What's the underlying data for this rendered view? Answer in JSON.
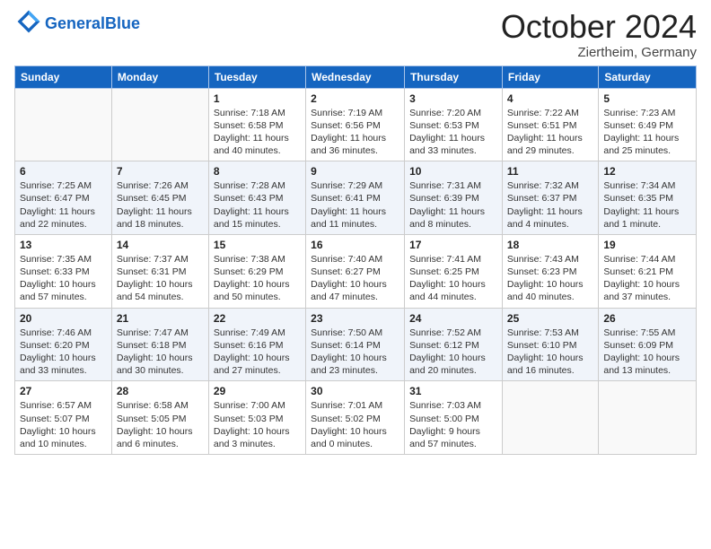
{
  "header": {
    "logo_general": "General",
    "logo_blue": "Blue",
    "month": "October 2024",
    "location": "Ziertheim, Germany"
  },
  "weekdays": [
    "Sunday",
    "Monday",
    "Tuesday",
    "Wednesday",
    "Thursday",
    "Friday",
    "Saturday"
  ],
  "weeks": [
    [
      {
        "day": "",
        "info": ""
      },
      {
        "day": "",
        "info": ""
      },
      {
        "day": "1",
        "info": "Sunrise: 7:18 AM\nSunset: 6:58 PM\nDaylight: 11 hours and 40 minutes."
      },
      {
        "day": "2",
        "info": "Sunrise: 7:19 AM\nSunset: 6:56 PM\nDaylight: 11 hours and 36 minutes."
      },
      {
        "day": "3",
        "info": "Sunrise: 7:20 AM\nSunset: 6:53 PM\nDaylight: 11 hours and 33 minutes."
      },
      {
        "day": "4",
        "info": "Sunrise: 7:22 AM\nSunset: 6:51 PM\nDaylight: 11 hours and 29 minutes."
      },
      {
        "day": "5",
        "info": "Sunrise: 7:23 AM\nSunset: 6:49 PM\nDaylight: 11 hours and 25 minutes."
      }
    ],
    [
      {
        "day": "6",
        "info": "Sunrise: 7:25 AM\nSunset: 6:47 PM\nDaylight: 11 hours and 22 minutes."
      },
      {
        "day": "7",
        "info": "Sunrise: 7:26 AM\nSunset: 6:45 PM\nDaylight: 11 hours and 18 minutes."
      },
      {
        "day": "8",
        "info": "Sunrise: 7:28 AM\nSunset: 6:43 PM\nDaylight: 11 hours and 15 minutes."
      },
      {
        "day": "9",
        "info": "Sunrise: 7:29 AM\nSunset: 6:41 PM\nDaylight: 11 hours and 11 minutes."
      },
      {
        "day": "10",
        "info": "Sunrise: 7:31 AM\nSunset: 6:39 PM\nDaylight: 11 hours and 8 minutes."
      },
      {
        "day": "11",
        "info": "Sunrise: 7:32 AM\nSunset: 6:37 PM\nDaylight: 11 hours and 4 minutes."
      },
      {
        "day": "12",
        "info": "Sunrise: 7:34 AM\nSunset: 6:35 PM\nDaylight: 11 hours and 1 minute."
      }
    ],
    [
      {
        "day": "13",
        "info": "Sunrise: 7:35 AM\nSunset: 6:33 PM\nDaylight: 10 hours and 57 minutes."
      },
      {
        "day": "14",
        "info": "Sunrise: 7:37 AM\nSunset: 6:31 PM\nDaylight: 10 hours and 54 minutes."
      },
      {
        "day": "15",
        "info": "Sunrise: 7:38 AM\nSunset: 6:29 PM\nDaylight: 10 hours and 50 minutes."
      },
      {
        "day": "16",
        "info": "Sunrise: 7:40 AM\nSunset: 6:27 PM\nDaylight: 10 hours and 47 minutes."
      },
      {
        "day": "17",
        "info": "Sunrise: 7:41 AM\nSunset: 6:25 PM\nDaylight: 10 hours and 44 minutes."
      },
      {
        "day": "18",
        "info": "Sunrise: 7:43 AM\nSunset: 6:23 PM\nDaylight: 10 hours and 40 minutes."
      },
      {
        "day": "19",
        "info": "Sunrise: 7:44 AM\nSunset: 6:21 PM\nDaylight: 10 hours and 37 minutes."
      }
    ],
    [
      {
        "day": "20",
        "info": "Sunrise: 7:46 AM\nSunset: 6:20 PM\nDaylight: 10 hours and 33 minutes."
      },
      {
        "day": "21",
        "info": "Sunrise: 7:47 AM\nSunset: 6:18 PM\nDaylight: 10 hours and 30 minutes."
      },
      {
        "day": "22",
        "info": "Sunrise: 7:49 AM\nSunset: 6:16 PM\nDaylight: 10 hours and 27 minutes."
      },
      {
        "day": "23",
        "info": "Sunrise: 7:50 AM\nSunset: 6:14 PM\nDaylight: 10 hours and 23 minutes."
      },
      {
        "day": "24",
        "info": "Sunrise: 7:52 AM\nSunset: 6:12 PM\nDaylight: 10 hours and 20 minutes."
      },
      {
        "day": "25",
        "info": "Sunrise: 7:53 AM\nSunset: 6:10 PM\nDaylight: 10 hours and 16 minutes."
      },
      {
        "day": "26",
        "info": "Sunrise: 7:55 AM\nSunset: 6:09 PM\nDaylight: 10 hours and 13 minutes."
      }
    ],
    [
      {
        "day": "27",
        "info": "Sunrise: 6:57 AM\nSunset: 5:07 PM\nDaylight: 10 hours and 10 minutes."
      },
      {
        "day": "28",
        "info": "Sunrise: 6:58 AM\nSunset: 5:05 PM\nDaylight: 10 hours and 6 minutes."
      },
      {
        "day": "29",
        "info": "Sunrise: 7:00 AM\nSunset: 5:03 PM\nDaylight: 10 hours and 3 minutes."
      },
      {
        "day": "30",
        "info": "Sunrise: 7:01 AM\nSunset: 5:02 PM\nDaylight: 10 hours and 0 minutes."
      },
      {
        "day": "31",
        "info": "Sunrise: 7:03 AM\nSunset: 5:00 PM\nDaylight: 9 hours and 57 minutes."
      },
      {
        "day": "",
        "info": ""
      },
      {
        "day": "",
        "info": ""
      }
    ]
  ]
}
